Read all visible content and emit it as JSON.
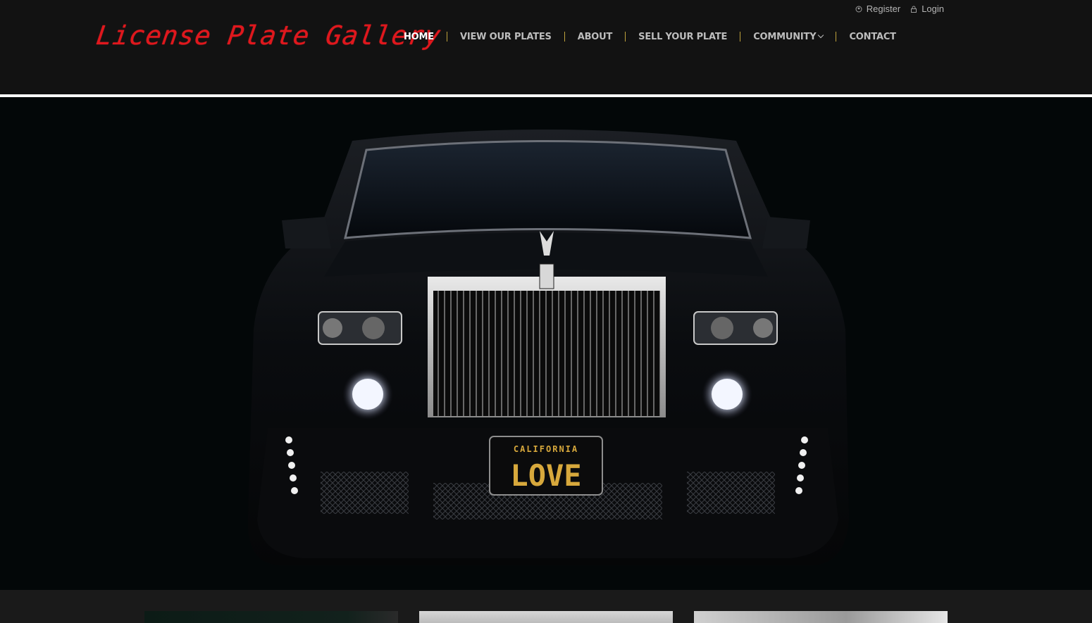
{
  "site": {
    "logo_text": "License Plate Gallery"
  },
  "topbar": {
    "register_label": "Register",
    "login_label": "Login"
  },
  "nav": {
    "items": [
      {
        "label": "HOME"
      },
      {
        "label": "VIEW OUR PLATES"
      },
      {
        "label": "ABOUT"
      },
      {
        "label": "SELL YOUR PLATE"
      },
      {
        "label": "COMMUNITY"
      },
      {
        "label": "CONTACT"
      }
    ]
  },
  "hero": {
    "plate_state": "CALIFORNIA",
    "plate_text": "LOVE"
  },
  "colors": {
    "logo": "#e0171d",
    "nav_separator": "#bfa23c",
    "plate_text": "#d7a83c"
  }
}
